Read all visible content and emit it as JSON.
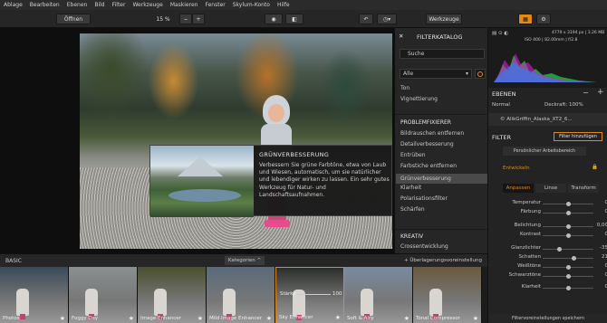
{
  "menubar": [
    "Ablage",
    "Bearbeiten",
    "Ebenen",
    "Bild",
    "Filter",
    "Werkzeuge",
    "Maskieren",
    "Fenster",
    "Skylum-Konto",
    "Hilfe"
  ],
  "toolbar": {
    "open": "Öffnen",
    "zoom": "15 %",
    "zoom_minus": "−",
    "zoom_plus": "+",
    "tools": "Werkzeuge"
  },
  "popup": {
    "title": "GRÜNVERBESSERUNG",
    "desc": "Verbessern Sie grüne Farbtöne, etwa von Laub und Wiesen, automatisch, um sie natürlicher und lebendiger wirken zu lassen. Ein sehr gutes Werkzeug für Natur- und Landschaftsaufnahmen."
  },
  "catalog": {
    "title": "FILTERKATALOG",
    "search_placeholder": "Suche",
    "select": "Alle",
    "items_top": [
      "Ton",
      "Vignettierung"
    ],
    "section1": "PROBLEMFIXIERER",
    "items": [
      "Bildrauschen entfernen",
      "Detailverbesserung",
      "Entrüben",
      "Farbstiche entfernen",
      "Grünverbesserung",
      "Klarheit",
      "Polarisationsfilter",
      "Schärfen"
    ],
    "selected_index": 4,
    "section2": "KREATIV",
    "items2": [
      "Crossentwicklung"
    ]
  },
  "strip": {
    "label": "BASIC",
    "categories": "Kategorien ^",
    "overlay": "+ Überlagerungsvoreinstellung",
    "thumbs": [
      {
        "label": "Photos",
        "bg": "#3a4a5a"
      },
      {
        "label": "Foggy Day",
        "bg": "#8a8f8f"
      },
      {
        "label": "Image Enhancer",
        "bg": "#4a5030"
      },
      {
        "label": "Mild Image Enhancer",
        "bg": "#5a6a7a"
      },
      {
        "label": "Sky Enhancer",
        "bg": "#2a2e2a"
      },
      {
        "label": "Soft & Airy",
        "bg": "#7a8aa0"
      },
      {
        "label": "Tonal Compressor",
        "bg": "#6a5a40"
      }
    ],
    "strength_label": "Stärke",
    "strength_value": "100"
  },
  "right": {
    "histo_info": "4779 x 3194 px  |  3.26 MB",
    "exif": "ISO 400  |  82.00mm  |  f/2.8",
    "layers_title": "EBENEN",
    "normal": "Normal",
    "opacity": "Deckraft: 100%",
    "layer_name": "© AlikGriffin_Alaska_XT2_6...",
    "filter_title": "FILTER",
    "add_filter": "Filter hinzufügen",
    "workspace": "Persönlicher Arbeitsbereich",
    "develop": "Entwickeln",
    "tabs": [
      "Anpassen",
      "Linse",
      "Transform"
    ],
    "sliders": [
      {
        "label": "Temperatur",
        "value": "0",
        "pos": 0.5
      },
      {
        "label": "Färbung",
        "value": "0",
        "pos": 0.5
      },
      {
        "label": "Belichtung",
        "value": "0,00",
        "pos": 0.5
      },
      {
        "label": "Kontrast",
        "value": "0",
        "pos": 0.5
      },
      {
        "label": "Glanzlichter",
        "value": "-35",
        "pos": 0.33
      },
      {
        "label": "Schatten",
        "value": "21",
        "pos": 0.6
      },
      {
        "label": "Weißtöne",
        "value": "0",
        "pos": 0.5
      },
      {
        "label": "Schwarztöne",
        "value": "0",
        "pos": 0.5
      },
      {
        "label": "Klarheit",
        "value": "0",
        "pos": 0.5
      }
    ],
    "save": "Filtervoreinstellungen speichern"
  }
}
